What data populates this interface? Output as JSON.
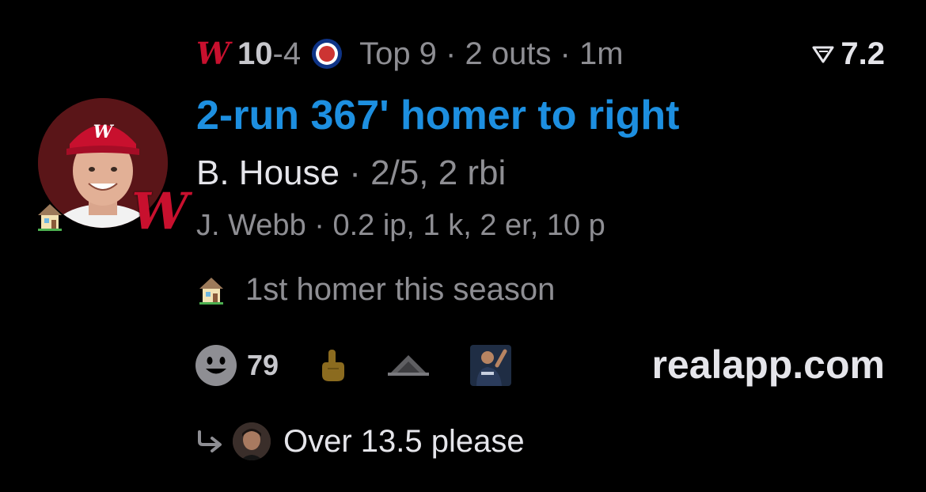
{
  "header": {
    "home_logo": "W",
    "score_lead": "10",
    "score_rest": "-4",
    "away_logo": "cubs-logo",
    "game_status": "Top 9 · 2 outs · 1m"
  },
  "rating": {
    "icon": "rating-arrow-icon",
    "value": "7.2"
  },
  "avatar": {
    "team_badge": "W",
    "badge_color": "#c8102e"
  },
  "play": {
    "headline": "2-run 367' homer to right",
    "batter_name": "B. House",
    "batter_stats": " · 2/5, 2 rbi",
    "pitcher_line": "J. Webb · 0.2 ip, 1 k, 2 er, 10 p"
  },
  "milestone": {
    "icon": "house-emoji-icon",
    "text": "1st homer this season"
  },
  "reactions": {
    "count": "79"
  },
  "brand": "realapp.com",
  "reply": {
    "text": "Over 13.5 please"
  },
  "colors": {
    "accent": "#1d8fe0",
    "nationals_red": "#c8102e",
    "muted": "#8e8e93"
  }
}
